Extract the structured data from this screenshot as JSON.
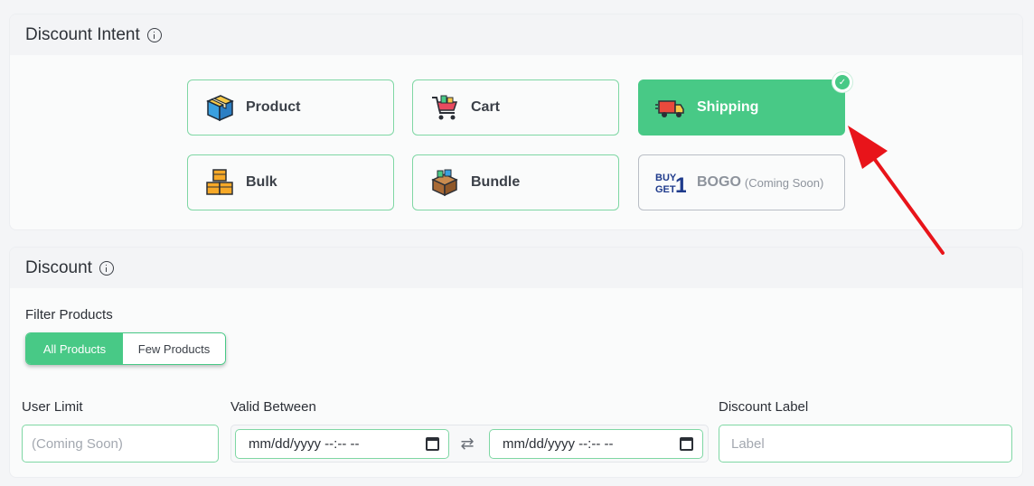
{
  "intent": {
    "title": "Discount Intent",
    "options": [
      {
        "label": "Product",
        "icon": "box-icon"
      },
      {
        "label": "Cart",
        "icon": "shopping-cart-icon"
      },
      {
        "label": "Shipping",
        "icon": "delivery-truck-icon",
        "selected": true
      },
      {
        "label": "Bulk",
        "icon": "stacked-boxes-icon"
      },
      {
        "label": "Bundle",
        "icon": "bundle-box-icon"
      },
      {
        "label": "BOGO",
        "sublabel": "(Coming Soon)",
        "icon": "buy-get-one-icon",
        "disabled": true
      }
    ],
    "bogo_icon_text": {
      "line1": "BUY",
      "line2": "GET",
      "digit": "1"
    }
  },
  "discount": {
    "title": "Discount",
    "filter_label": "Filter Products",
    "filter_options": [
      "All Products",
      "Few Products"
    ],
    "filter_selected": "All Products",
    "user_limit_label": "User Limit",
    "user_limit_placeholder": "(Coming Soon)",
    "valid_between_label": "Valid Between",
    "date_start_placeholder": "mm/dd/yyyy --:-- --",
    "date_end_placeholder": "mm/dd/yyyy --:-- --",
    "discount_label_label": "Discount Label",
    "discount_label_placeholder": "Label"
  },
  "colors": {
    "accent": "#48c986",
    "annotation_arrow": "#e8141a"
  }
}
